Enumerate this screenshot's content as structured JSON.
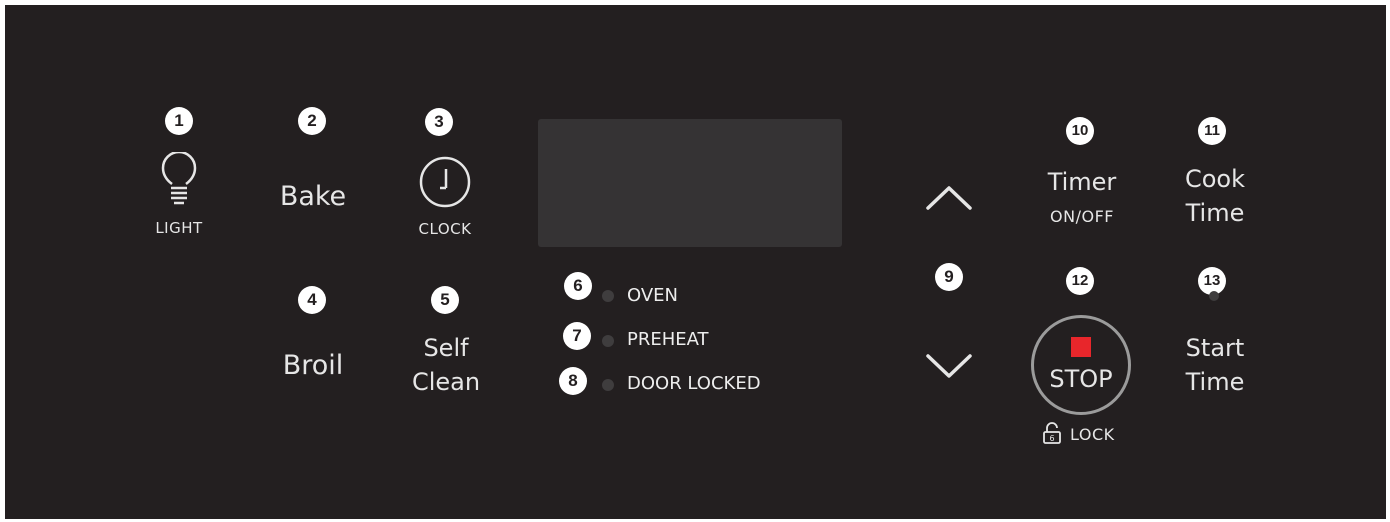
{
  "colors": {
    "panel": "#231f20",
    "display": "#353334",
    "stop_square": "#e8262b",
    "led_off": "#3f3d3e",
    "text": "#e6e6e6"
  },
  "badges": [
    "1",
    "2",
    "3",
    "4",
    "5",
    "6",
    "7",
    "8",
    "9",
    "10",
    "11",
    "12",
    "13"
  ],
  "buttons": {
    "light": {
      "label": "LIGHT",
      "icon": "lightbulb-icon"
    },
    "bake": {
      "label": "Bake"
    },
    "clock": {
      "label": "CLOCK",
      "icon": "clock-icon"
    },
    "broil": {
      "label": "Broil"
    },
    "self_clean": {
      "line1": "Self",
      "line2": "Clean"
    },
    "up": {
      "icon": "chevron-up-icon"
    },
    "down": {
      "icon": "chevron-down-icon"
    },
    "timer": {
      "line1": "Timer",
      "line2": "ON/OFF"
    },
    "cook_time": {
      "line1": "Cook",
      "line2": "Time"
    },
    "stop": {
      "label": "STOP",
      "icon": "stop-square-icon",
      "lock_label": "LOCK",
      "lock_icon": "lock-icon",
      "lock_icon_text": "6"
    },
    "start_time": {
      "line1": "Start",
      "line2": "Time"
    }
  },
  "indicators": [
    {
      "label": "OVEN"
    },
    {
      "label": "PREHEAT"
    },
    {
      "label": "DOOR LOCKED"
    }
  ]
}
